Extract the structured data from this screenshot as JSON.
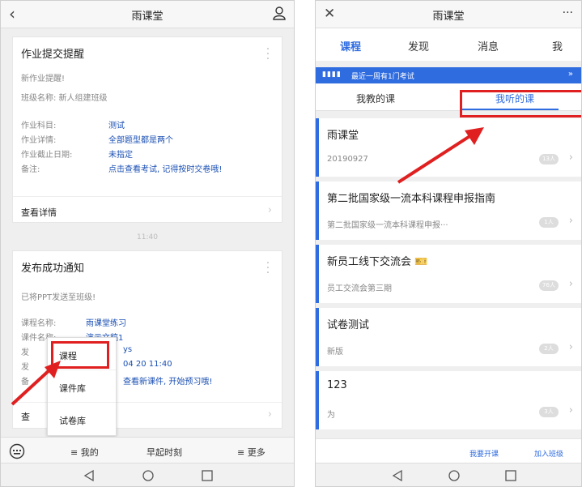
{
  "left": {
    "title": "雨课堂",
    "card1": {
      "title": "作业提交提醒",
      "line1": "新作业提醒!",
      "line2": "班级名称: 新人组建班级",
      "rows": [
        {
          "k": "作业科目:",
          "v": "测试"
        },
        {
          "k": "作业详情:",
          "v": "全部题型都是两个"
        },
        {
          "k": "作业截止日期:",
          "v": "未指定"
        },
        {
          "k": "备注:",
          "v": "点击查看考试, 记得按时交卷哦!"
        }
      ],
      "detail": "查看详情"
    },
    "timestamp": "11:40",
    "card2": {
      "title": "发布成功通知",
      "line1": "已将PPT发送至班级!",
      "rows": [
        {
          "k": "课程名称:",
          "v": "雨课堂练习"
        },
        {
          "k": "课件名称:",
          "v": "演示文稿1"
        },
        {
          "k": "发",
          "v": "ys"
        },
        {
          "k": "发",
          "v": "04 20 11:40"
        },
        {
          "k": "备",
          "v": "查看新课件, 开始预习哦!"
        }
      ],
      "detail": "查"
    },
    "popup": [
      "课程",
      "课件库",
      "试卷库"
    ],
    "bottom": [
      "≡ 我的",
      "早起时刻",
      "≡ 更多"
    ]
  },
  "right": {
    "title": "雨课堂",
    "tabs": [
      "课程",
      "发现",
      "消息",
      "我"
    ],
    "banner": "最近一周有1门考试",
    "subtabs": [
      "我教的课",
      "我听的课"
    ],
    "courses": [
      {
        "title": "雨课堂",
        "sub": "20190927",
        "badge": "13人"
      },
      {
        "title": "第二批国家级一流本科课程申报指南",
        "sub": "第二批国家级一流本科课程申报···",
        "badge": "1人"
      },
      {
        "title": "新员工线下交流会 🎫",
        "sub": "员工交流会第三期",
        "badge": "76人"
      },
      {
        "title": "试卷测试",
        "sub": "新版",
        "badge": "2人"
      },
      {
        "title": "123",
        "sub": "为",
        "badge": "3人"
      }
    ],
    "footer_links": [
      "我要开课",
      "加入班级"
    ]
  },
  "colors": {
    "accent": "#2f6ce0",
    "link": "#1a4fb3",
    "annotation": "#e02020"
  }
}
